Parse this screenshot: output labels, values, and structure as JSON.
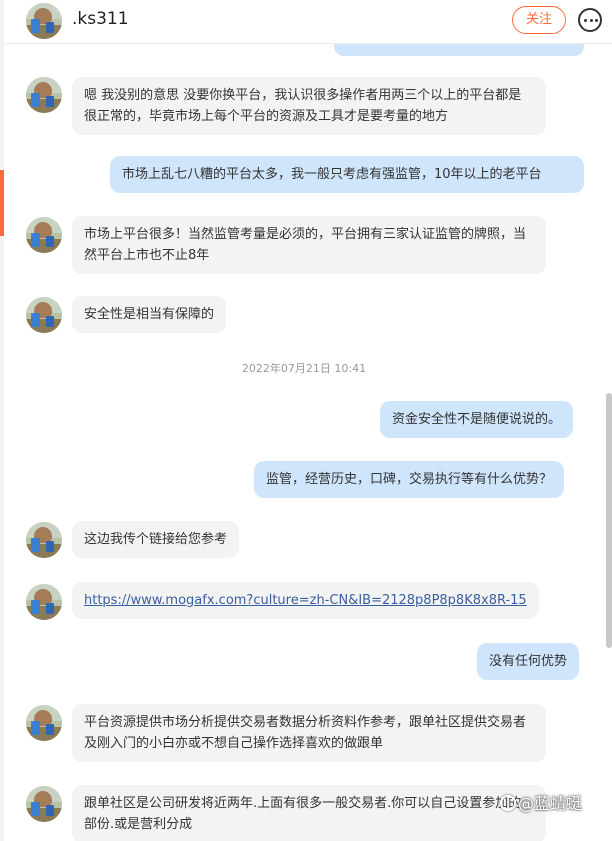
{
  "header": {
    "name": ".ks311",
    "follow_label": "关注",
    "more_icon": "more-icon"
  },
  "messages": [
    {
      "side": "in",
      "text": "嗯 我没别的意思 没要你换平台，我认识很多操作者用两三个以上的平台都是很正常的，毕竟市场上每个平台的资源及工具才是要考量的地方"
    },
    {
      "side": "out",
      "text": "市场上乱七八糟的平台太多，我一般只考虑有强监管，10年以上的老平台"
    },
    {
      "side": "in",
      "text": "市场上平台很多！当然监管考量是必须的，平台拥有三家认证监管的牌照，当然平台上市也不止8年"
    },
    {
      "side": "in",
      "text": "安全性是相当有保障的"
    },
    {
      "side": "out",
      "text": "资金安全性不是随便说说的。"
    },
    {
      "side": "out",
      "text": "监管，经营历史，口碑，交易执行等有什么优势？"
    },
    {
      "side": "in",
      "text": "这边我传个链接给您参考"
    },
    {
      "side": "in",
      "text": "https://www.mogafx.com?culture=zh-CN&IB=2128p8P8p8K8x8R-15"
    },
    {
      "side": "out",
      "text": "没有任何优势"
    },
    {
      "side": "in",
      "text": "平台资源提供市场分析提供交易者数据分析资料作参考，跟单社区提供交易者及刚入门的小白亦或不想自己操作选择喜欢的做跟单"
    },
    {
      "side": "in",
      "text": "跟单社区是公司研发将近两年.上面有很多一般交易者.你可以自己设置参加的部份.或是营利分成"
    }
  ],
  "timestamp": "2022年07月21日 10:41",
  "watermark": "@蓝蜻蜓",
  "colors": {
    "accent": "#ff6a3d",
    "incoming_bubble": "#f3f3f3",
    "outgoing_bubble": "#cfe5fc",
    "link": "#3a5fa0"
  }
}
